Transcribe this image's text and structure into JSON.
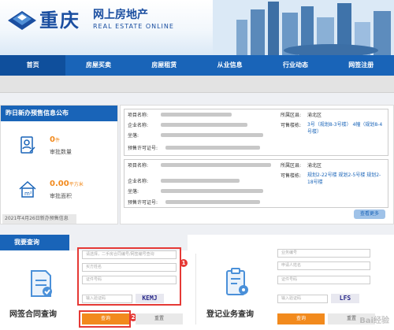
{
  "brand": {
    "cn": "重庆",
    "sub": "网上房地产",
    "en": "REAL ESTATE ONLINE"
  },
  "nav": [
    "首页",
    "房屋买卖",
    "房屋租赁",
    "从业信息",
    "行业动态",
    "网签注册"
  ],
  "notice": {
    "title": "昨日新办预售信息公布",
    "stat1": {
      "value": "0",
      "unit": "件",
      "label": "审批数量"
    },
    "stat2": {
      "value": "0.00",
      "unit": "平方米",
      "label": "审批面积"
    },
    "date": "2021年4月26日新办预售信息",
    "more": "查看更多",
    "cards": [
      {
        "project": "项目名称:",
        "company": "企业名称:",
        "location": "坐落:",
        "permit": "预售许可证号:",
        "district_label": "所属区县:",
        "district": "渝北区",
        "sellable_label": "可售楼栋:",
        "sellable": "3号（规划8-3号楼） 4幢（规划8-4号楼）"
      },
      {
        "project": "项目名称:",
        "company": "企业名称:",
        "location": "坐落:",
        "permit": "预售许可证号:",
        "district_label": "所属区县:",
        "district": "渝北区",
        "sellable_label": "可售楼栋:",
        "sellable": "规划2-22号楼 规划2-5号楼 规划2-18号楼"
      }
    ]
  },
  "query": {
    "title": "我要查询",
    "left": {
      "label": "网签合同查询",
      "placeholders": [
        "请选择，二手房合同编号/网签编号查询",
        "买方姓名",
        "证件号码",
        "输入验证码"
      ],
      "captcha": "KEMJ",
      "btn_query": "查询",
      "btn_reset": "重置",
      "marker1": "1",
      "marker2": "2"
    },
    "right": {
      "label": "登记业务查询",
      "placeholders": [
        "业务编号",
        "申请人姓名",
        "证件号码",
        "输入验证码"
      ],
      "captcha": "LFS",
      "btn_query": "查询",
      "btn_reset": "重置"
    }
  },
  "watermark": "Bai经验"
}
